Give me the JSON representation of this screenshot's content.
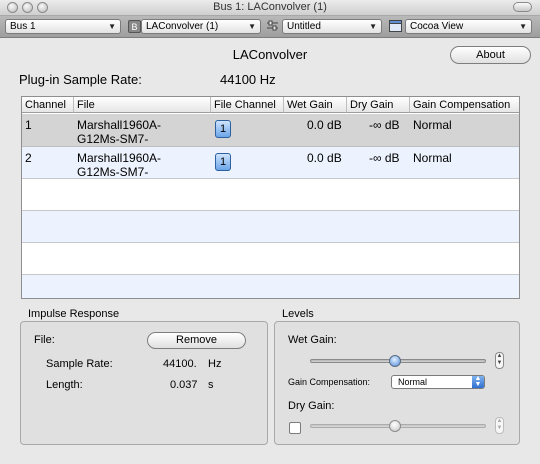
{
  "window": {
    "title": "Bus 1: LAConvolver (1)"
  },
  "toolbar": {
    "bus_select": "Bus 1",
    "bypass_badge": "B",
    "plugin_select": "LAConvolver (1)",
    "preset_select": "Untitled",
    "view_select": "Cocoa View"
  },
  "header": {
    "plugin_name": "LAConvolver",
    "about_label": "About",
    "sample_rate_label": "Plug-in Sample Rate:",
    "sample_rate_value": "44100  Hz"
  },
  "table": {
    "columns": [
      "Channel",
      "File",
      "File Channel",
      "Wet Gain",
      "Dry Gain",
      "Gain Compensation"
    ],
    "rows": [
      {
        "channel": "1",
        "file_line1": "Marshall1960A-",
        "file_line2": "G12Ms-SM7-",
        "file_channel": "1",
        "wet_gain": "0.0 dB",
        "dry_gain": "-∞ dB",
        "gain_comp": "Normal",
        "selected": true
      },
      {
        "channel": "2",
        "file_line1": "Marshall1960A-",
        "file_line2": "G12Ms-SM7-",
        "file_channel": "1",
        "wet_gain": "0.0 dB",
        "dry_gain": "-∞ dB",
        "gain_comp": "Normal",
        "selected": false
      }
    ],
    "empty_row_count": 4
  },
  "impulse": {
    "title": "Impulse Response",
    "file_label": "File:",
    "remove_label": "Remove",
    "sample_rate_label": "Sample Rate:",
    "sample_rate_value": "44100.",
    "sample_rate_unit": "Hz",
    "length_label": "Length:",
    "length_value": "0.037",
    "length_unit": "s"
  },
  "levels": {
    "title": "Levels",
    "wet_gain_label": "Wet Gain:",
    "wet_gain_level": 0.48,
    "gain_comp_label": "Gain Compensation:",
    "gain_comp_value": "Normal",
    "dry_gain_label": "Dry Gain:",
    "dry_gain_level": 0.48,
    "dry_gain_enabled": false
  },
  "colors": {
    "selected_row": "#d4d4d4",
    "alt_row": "#edf3fe",
    "accent": "#3c7ad6"
  }
}
